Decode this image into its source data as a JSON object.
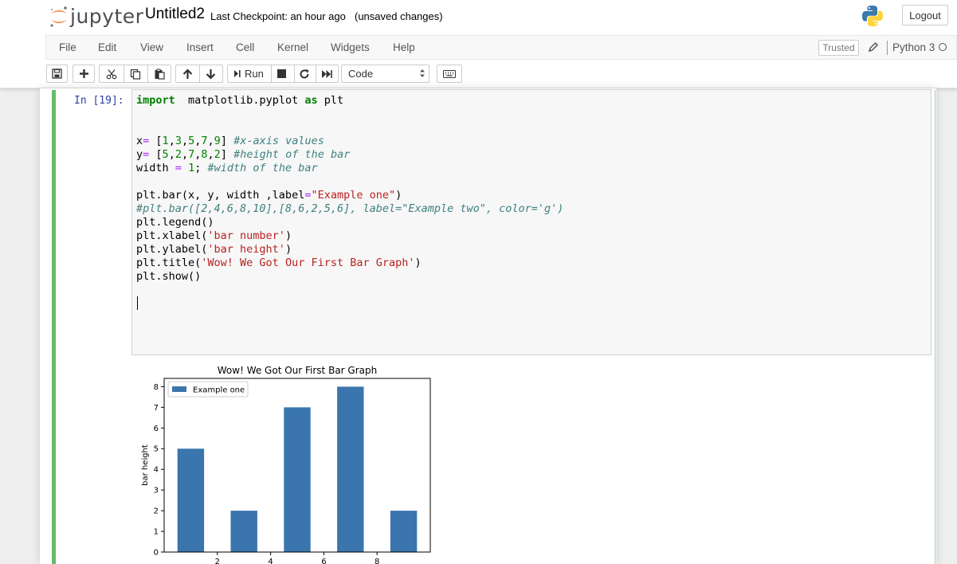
{
  "header": {
    "logo_text": "jupyter",
    "notebook_name": "Untitled2",
    "checkpoint": "Last Checkpoint: an hour ago",
    "unsaved": "(unsaved changes)",
    "logout_label": "Logout"
  },
  "menu": {
    "items": [
      "File",
      "Edit",
      "View",
      "Insert",
      "Cell",
      "Kernel",
      "Widgets",
      "Help"
    ],
    "trusted_label": "Trusted",
    "kernel_name": "Python 3"
  },
  "toolbar": {
    "run_label": "Run",
    "cell_type": "Code",
    "icons": [
      "save-icon",
      "add-cell-icon",
      "cut-icon",
      "copy-icon",
      "paste-icon",
      "move-up-icon",
      "move-down-icon",
      "run-icon",
      "stop-icon",
      "restart-icon",
      "fast-forward-icon",
      "keyboard-icon"
    ]
  },
  "cell": {
    "prompt": "In [19]:",
    "code": [
      [
        [
          "kw",
          "import"
        ],
        [
          "",
          "  matplotlib.pyplot "
        ],
        [
          "kw",
          "as"
        ],
        [
          "",
          " plt"
        ]
      ],
      [],
      [],
      [
        [
          "",
          "x"
        ],
        [
          "op",
          "="
        ],
        [
          "",
          " ["
        ],
        [
          "num",
          "1"
        ],
        [
          "",
          ","
        ],
        [
          "num",
          "3"
        ],
        [
          "",
          ","
        ],
        [
          "num",
          "5"
        ],
        [
          "",
          ","
        ],
        [
          "num",
          "7"
        ],
        [
          "",
          ","
        ],
        [
          "num",
          "9"
        ],
        [
          "",
          "] "
        ],
        [
          "cmt",
          "#x-axis values"
        ]
      ],
      [
        [
          "",
          "y"
        ],
        [
          "op",
          "="
        ],
        [
          "",
          " ["
        ],
        [
          "num",
          "5"
        ],
        [
          "",
          ","
        ],
        [
          "num",
          "2"
        ],
        [
          "",
          ","
        ],
        [
          "num",
          "7"
        ],
        [
          "",
          ","
        ],
        [
          "num",
          "8"
        ],
        [
          "",
          ","
        ],
        [
          "num",
          "2"
        ],
        [
          "",
          "] "
        ],
        [
          "cmt",
          "#height of the bar"
        ]
      ],
      [
        [
          "",
          "width "
        ],
        [
          "op",
          "="
        ],
        [
          "",
          " "
        ],
        [
          "num",
          "1"
        ],
        [
          "",
          "; "
        ],
        [
          "cmt",
          "#width of the bar"
        ]
      ],
      [],
      [
        [
          "",
          "plt.bar(x, y, width ,label"
        ],
        [
          "op",
          "="
        ],
        [
          "str",
          "\"Example one\""
        ],
        [
          "",
          ")"
        ]
      ],
      [
        [
          "cmt",
          "#plt.bar([2,4,6,8,10],[8,6,2,5,6], label=\"Example two\", color='g')"
        ]
      ],
      [
        [
          "",
          "plt.legend()"
        ]
      ],
      [
        [
          "",
          "plt.xlabel("
        ],
        [
          "str",
          "'bar number'"
        ],
        [
          "",
          ")"
        ]
      ],
      [
        [
          "",
          "plt.ylabel("
        ],
        [
          "str",
          "'bar height'"
        ],
        [
          "",
          ")"
        ]
      ],
      [
        [
          "",
          "plt.title("
        ],
        [
          "str",
          "'Wow! We Got Our First Bar Graph'"
        ],
        [
          "",
          ")"
        ]
      ],
      [
        [
          "",
          "plt.show()"
        ]
      ]
    ]
  },
  "chart_data": {
    "type": "bar",
    "title": "Wow! We Got Our First Bar Graph",
    "xlabel": "",
    "ylabel": "bar height",
    "x": [
      1,
      3,
      5,
      7,
      9
    ],
    "bar_width": 1,
    "series": [
      {
        "name": "Example one",
        "values": [
          5,
          2,
          7,
          8,
          2
        ],
        "color": "#3a75ad"
      }
    ],
    "xlim": [
      0,
      10
    ],
    "ylim": [
      0,
      8.4
    ],
    "xticks": [
      2,
      4,
      6,
      8
    ],
    "yticks": [
      0,
      1,
      2,
      3,
      4,
      5,
      6,
      7,
      8
    ],
    "legend": "upper-left",
    "grid": false
  },
  "colors": {
    "cell_accent": "#66bb6a",
    "prompt": "#303f9f",
    "bar": "#3a75ad"
  }
}
